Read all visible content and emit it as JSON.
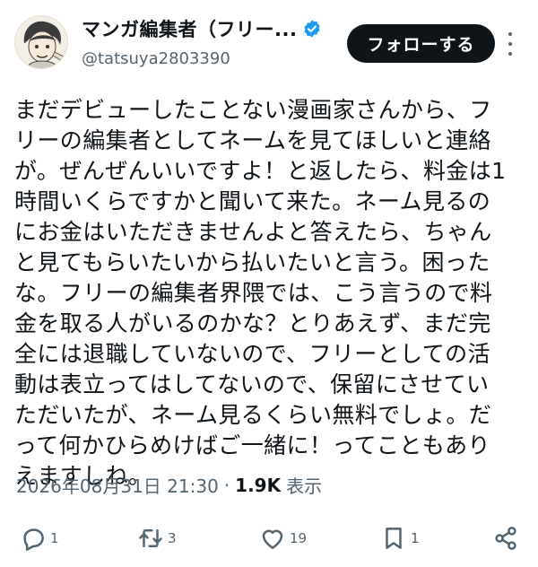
{
  "author": {
    "display_name": "マンガ編集者（フリー...",
    "handle": "@tatsuya2803390",
    "avatar_icon": "avatar-illustration",
    "verified_icon": "verified-badge-icon",
    "verified_color": "#1d9bf0"
  },
  "header": {
    "follow_label": "フォローする",
    "more_icon": "more-vertical-icon"
  },
  "post": {
    "text": "まだデビューしたことない漫画家さんから、フ\nリーの編集者としてネームを見てほしいと連絡\nが。ぜんぜんいいですよ！と返したら、料金は1\n時間いくらですかと聞いて来た。ネーム見るの\nにお金はいただきませんよと答えたら、ちゃん\nと見てもらいたいから払いたいと言う。困った\nな。フリーの編集者界隈では、こう言うので料\n金を取る人がいるのかな？とりあえず、まだ完\n全には退職していないので、フリーとしての活\n動は表立ってはしてないので、保留にさせてい\nただいたが、ネーム見るくらい無料でしょ。だ\nって何かひらめけばご一緒に！ってこともあり\nえますしね。"
  },
  "meta": {
    "timestamp": "2026年08月31日 21:30",
    "separator": "·",
    "views_count": "1.9K",
    "views_label": "表示"
  },
  "actions": {
    "replies": "1",
    "reposts": "3",
    "likes": "19",
    "bookmarks": "1",
    "icon_color": "#536471"
  }
}
